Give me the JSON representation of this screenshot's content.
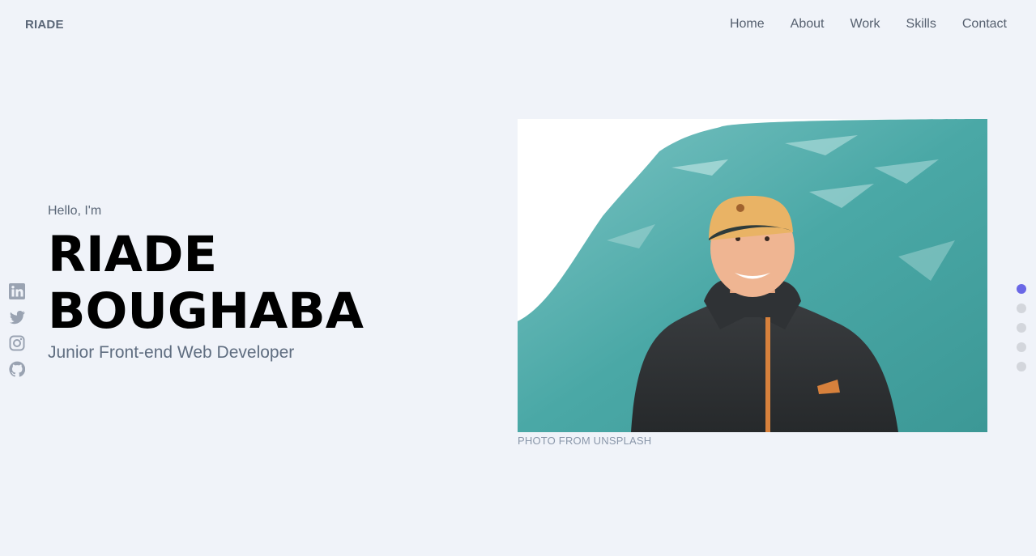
{
  "brand": "RIADE",
  "nav": {
    "home": "Home",
    "about": "About",
    "work": "Work",
    "skills": "Skills",
    "contact": "Contact"
  },
  "hero": {
    "greeting": "Hello, I'm",
    "first_name": "RIADE",
    "last_name": "BOUGHABA",
    "role": "Junior Front-end Web Developer"
  },
  "photo": {
    "caption": "PHOTO FROM UNSPLASH"
  },
  "social": [
    "linkedin-icon",
    "twitter-icon",
    "instagram-icon",
    "github-icon"
  ],
  "section_dots": {
    "count": 5,
    "active_index": 0
  },
  "colors": {
    "background": "#f0f3f9",
    "accent": "#6a67e6",
    "inactive_dot": "#d3d6dc",
    "icon": "#9aa3b2"
  }
}
